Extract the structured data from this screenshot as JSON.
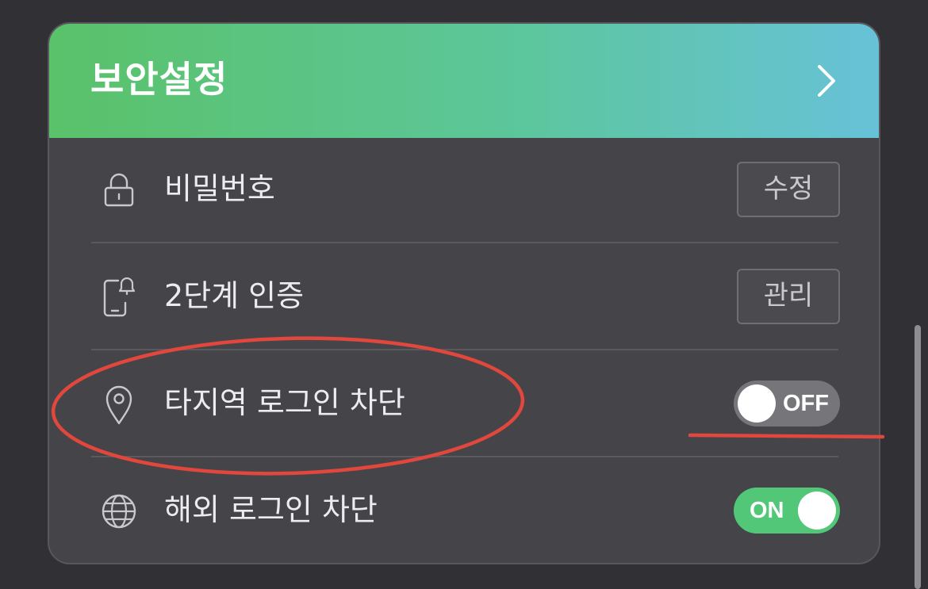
{
  "header": {
    "title": "보안설정",
    "chevron_icon": "chevron-right-icon"
  },
  "rows": [
    {
      "icon": "lock-icon",
      "label": "비밀번호",
      "control": "button",
      "button_label": "수정"
    },
    {
      "icon": "phone-bell-icon",
      "label": "2단계 인증",
      "control": "button",
      "button_label": "관리"
    },
    {
      "icon": "location-pin-icon",
      "label": "타지역 로그인 차단",
      "control": "toggle",
      "state": "OFF",
      "enabled": false
    },
    {
      "icon": "globe-icon",
      "label": "해외 로그인 차단",
      "control": "toggle",
      "state": "ON",
      "enabled": true
    }
  ],
  "colors": {
    "background": "#313035",
    "card": "#454449",
    "header_gradient_start": "#5ac269",
    "header_gradient_end": "#67c2d8",
    "toggle_on": "#52c778",
    "toggle_off": "#76757a",
    "annotation": "#e1473c"
  }
}
